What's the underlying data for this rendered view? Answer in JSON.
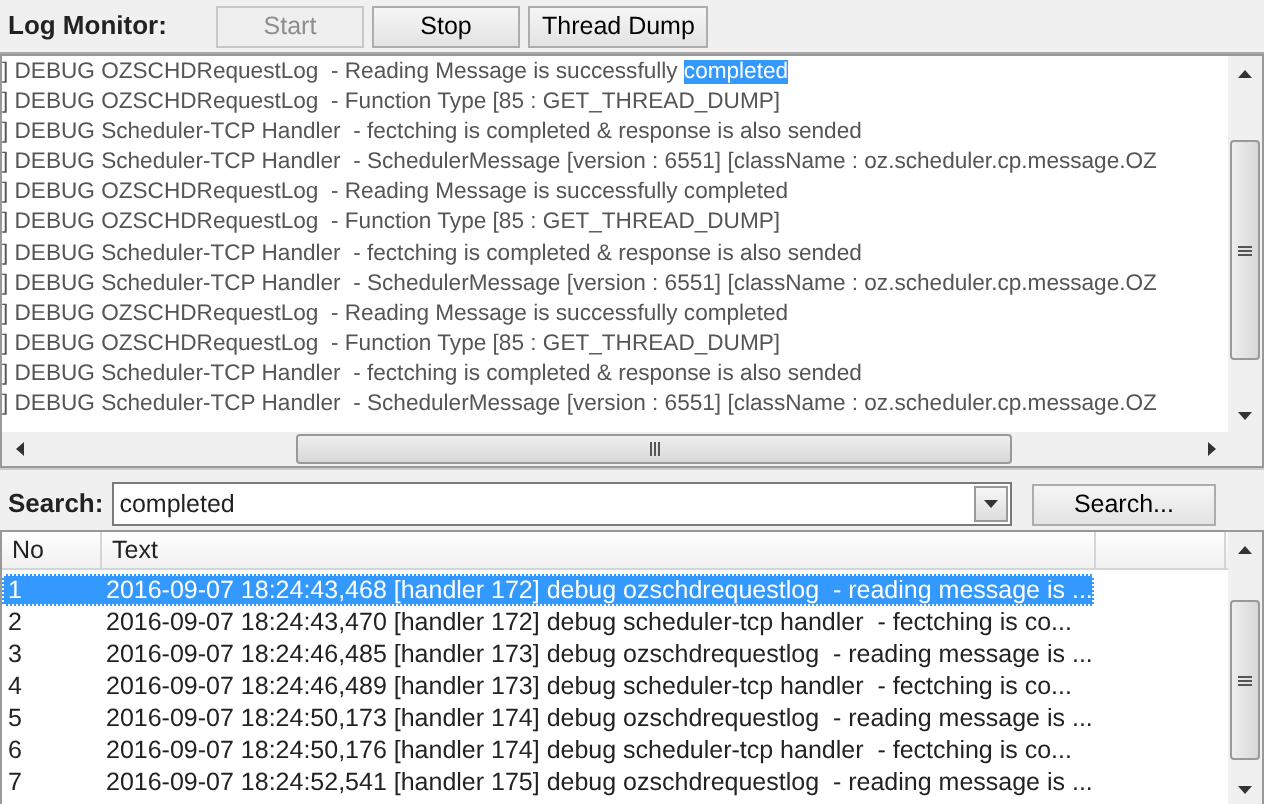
{
  "toolbar": {
    "label": "Log Monitor:",
    "buttons": [
      {
        "label": "Start",
        "disabled": true
      },
      {
        "label": "Stop",
        "disabled": false
      },
      {
        "label": "Thread Dump",
        "disabled": false
      }
    ]
  },
  "log_lines": [
    {
      "text": "] DEBUG OZSCHDRequestLog  - Reading Message is successfully ",
      "highlight": "completed"
    },
    {
      "text": "] DEBUG OZSCHDRequestLog  - Function Type [85 : GET_THREAD_DUMP]"
    },
    {
      "text": "] DEBUG Scheduler-TCP Handler  - fectching is completed & response is also sended"
    },
    {
      "text": "] DEBUG Scheduler-TCP Handler  - SchedulerMessage [version : 6551] [className : oz.scheduler.cp.message.OZ"
    },
    {
      "text": "] DEBUG OZSCHDRequestLog  - Reading Message is successfully completed"
    },
    {
      "text": "] DEBUG OZSCHDRequestLog  - Function Type [85 : GET_THREAD_DUMP]"
    },
    {
      "text": "] DEBUG Scheduler-TCP Handler  - fectching is completed & response is also sended"
    },
    {
      "text": "] DEBUG Scheduler-TCP Handler  - SchedulerMessage [version : 6551] [className : oz.scheduler.cp.message.OZ"
    },
    {
      "text": "] DEBUG OZSCHDRequestLog  - Reading Message is successfully completed"
    },
    {
      "text": "] DEBUG OZSCHDRequestLog  - Function Type [85 : GET_THREAD_DUMP]"
    },
    {
      "text": "] DEBUG Scheduler-TCP Handler  - fectching is completed & response is also sended"
    },
    {
      "text": "] DEBUG Scheduler-TCP Handler  - SchedulerMessage [version : 6551] [className : oz.scheduler.cp.message.OZ"
    }
  ],
  "search": {
    "label": "Search:",
    "value": "completed",
    "button": "Search..."
  },
  "results": {
    "columns": [
      "No",
      "Text"
    ],
    "rows": [
      {
        "no": "1",
        "text": "2016-09-07 18:24:43,468 [handler 172] debug ozschdrequestlog  - reading message is ...",
        "selected": true
      },
      {
        "no": "2",
        "text": "2016-09-07 18:24:43,470 [handler 172] debug scheduler-tcp handler  - fectching is co...",
        "selected": false
      },
      {
        "no": "3",
        "text": "2016-09-07 18:24:46,485 [handler 173] debug ozschdrequestlog  - reading message is ...",
        "selected": false
      },
      {
        "no": "4",
        "text": "2016-09-07 18:24:46,489 [handler 173] debug scheduler-tcp handler  - fectching is co...",
        "selected": false
      },
      {
        "no": "5",
        "text": "2016-09-07 18:24:50,173 [handler 174] debug ozschdrequestlog  - reading message is ...",
        "selected": false
      },
      {
        "no": "6",
        "text": "2016-09-07 18:24:50,176 [handler 174] debug scheduler-tcp handler  - fectching is co...",
        "selected": false
      },
      {
        "no": "7",
        "text": "2016-09-07 18:24:52,541 [handler 175] debug ozschdrequestlog  - reading message is ...",
        "selected": false
      }
    ]
  }
}
